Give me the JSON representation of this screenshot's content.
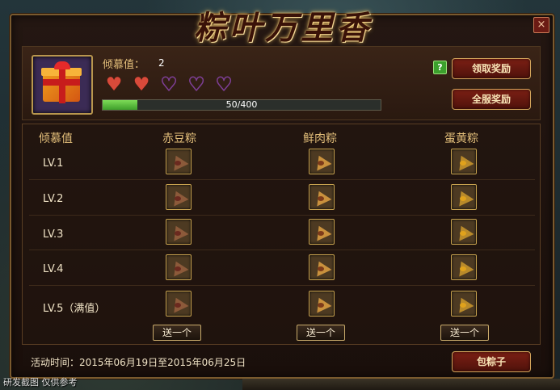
{
  "title": "粽叶万里香",
  "affection": {
    "label": "倾慕值：",
    "value": "2",
    "hearts_filled": 2,
    "hearts_total": 5
  },
  "progress": {
    "text": "50/400",
    "current": 50,
    "max": 400
  },
  "buttons": {
    "help": "?",
    "claim": "领取奖励",
    "server_reward": "全服奖励",
    "make": "包粽子",
    "close": "×"
  },
  "table": {
    "headers": [
      "倾慕值",
      "赤豆粽",
      "鲜肉粽",
      "蛋黄粽"
    ],
    "levels": [
      "LV.1",
      "LV.2",
      "LV.3",
      "LV.4",
      "LV.5（满值）"
    ],
    "send_label": "送一个"
  },
  "activity_time": "活动时间：2015年06月19日至2015年06月25日",
  "watermark": "研发截图 仅供参考",
  "colors": {
    "accent": "#e5c07b",
    "button": "#7c1f14",
    "progress": "#5cc23f"
  }
}
